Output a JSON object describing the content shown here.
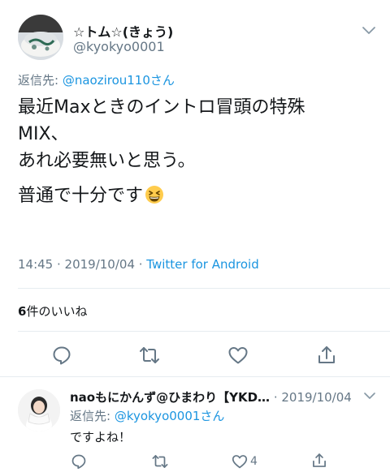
{
  "tweet": {
    "display_name": "☆トム☆(きょう)",
    "handle": "@kyokyo0001",
    "replying_prefix": "返信先: ",
    "replying_to": "@naozirou110さん",
    "lines": [
      "最近Maxときのイントロ冒頭の特殊",
      "MIX、",
      "あれ必要無いと思う。",
      "普通で十分です"
    ],
    "emoji": "grinning-squinting-face",
    "timestamp": "14:45 · 2019/10/04 · ",
    "source": "Twitter for Android",
    "likes_count": "6",
    "likes_label": "件のいいね"
  },
  "reply": {
    "name": "naoもにかんず@ひまわり【YKD…",
    "date": " · 2019/10/04",
    "replying_prefix": "返信先: ",
    "replying_to": "@kyokyo0001さん",
    "text": "ですよね！",
    "like_count": "4"
  },
  "icons": {
    "main_actions": [
      "reply-icon",
      "retweet-icon",
      "like-icon",
      "share-icon"
    ],
    "reply_actions": [
      "reply-icon",
      "retweet-icon",
      "like-icon",
      "share-icon"
    ],
    "menu": "chevron-down-icon"
  },
  "colors": {
    "link": "#1b95e0",
    "secondary_text": "#657786",
    "icon": "#657786",
    "divider": "#e6ecf0"
  }
}
